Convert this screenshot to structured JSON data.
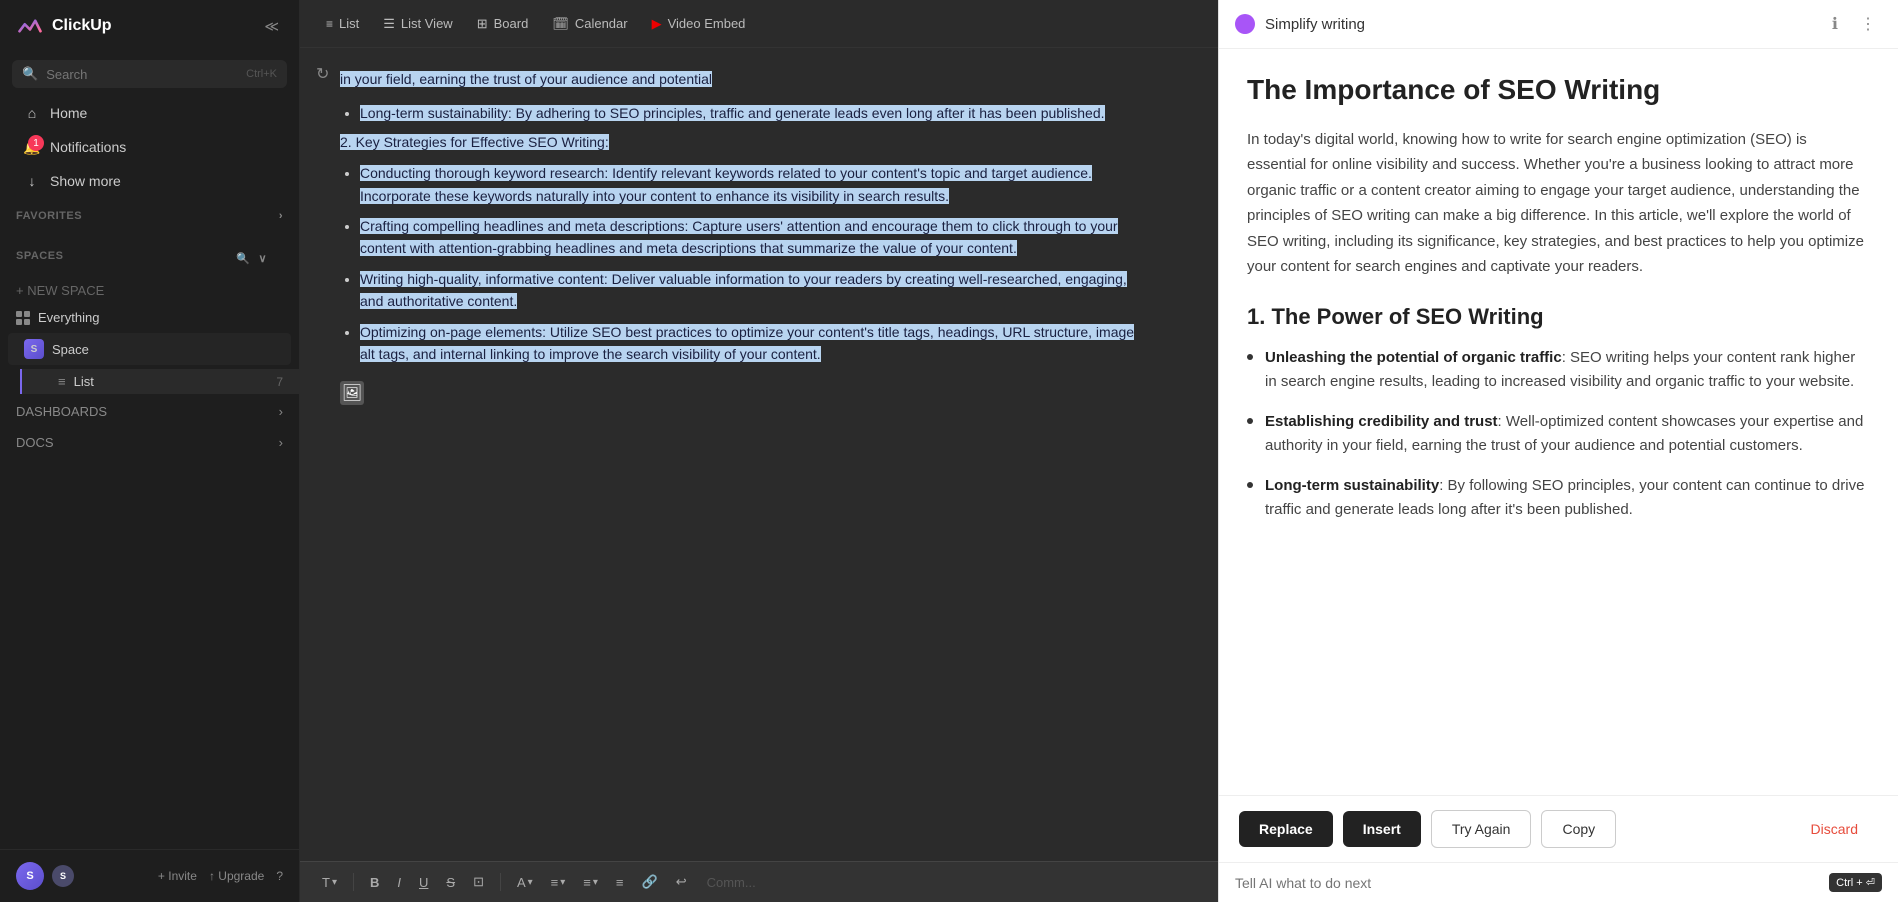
{
  "app": {
    "name": "ClickUp"
  },
  "sidebar": {
    "search_placeholder": "Search",
    "search_shortcut": "Ctrl+K",
    "nav": {
      "home": "Home",
      "notifications": "Notifications",
      "notifications_badge": "1",
      "show_more": "Show more"
    },
    "sections": {
      "favorites": "FAVORITES",
      "spaces": "SPACES"
    },
    "spaces_items": [
      {
        "label": "Everything",
        "icon": "grid"
      },
      {
        "label": "Space",
        "icon": "S"
      }
    ],
    "list_item": {
      "label": "List",
      "count": "7"
    },
    "new_space": "+ NEW SPACE",
    "dashboards": "DASHBOARDS",
    "docs": "DOCS",
    "footer": {
      "invite": "Invite",
      "upgrade": "Upgrade",
      "help": "?"
    }
  },
  "topbar": {
    "tabs": [
      {
        "label": "List",
        "icon": "≡",
        "active": false
      },
      {
        "label": "List View",
        "icon": "☰",
        "active": false
      },
      {
        "label": "Board",
        "icon": "⊞",
        "active": false
      },
      {
        "label": "Calendar",
        "icon": "📅",
        "active": false
      },
      {
        "label": "Video Embed",
        "icon": "▶",
        "active": false
      }
    ]
  },
  "document": {
    "content": {
      "intro_highlighted": "in your field, earning the trust of your audience and potential",
      "bullets_highlighted": [
        {
          "text": "Long-term sustainability: By adhering to SEO principles, traffic and generate leads even long after it has been published.",
          "highlighted": true
        },
        {
          "num": "2.",
          "label": "Key Strategies for Effective SEO Writing:",
          "highlighted": true
        },
        {
          "text": "Conducting thorough keyword research: Identify relevant keywords related to your content's topic and target audience. Incorporate these keywords naturally into your content to enhance its visibility in search results.",
          "highlighted": true
        },
        {
          "text": "Crafting compelling headlines and meta descriptions: Capture users' attention and encourage them to click through to your content with attention-grabbing headlines and meta descriptions that summarize the value of your content.",
          "highlighted": true
        },
        {
          "text": "Writing high-quality, informative content: Deliver valuable information to your readers by creating well-researched, engaging, and authoritative content.",
          "highlighted": true
        },
        {
          "text": "Optimizing on-page elements: Utilize SEO best practices to optimize your content's title tags, headings, URL structure, image alt tags, and internal linking to improve the search visibility of your content.",
          "highlighted": true
        }
      ]
    }
  },
  "toolbar": {
    "buttons": [
      "T",
      "B",
      "I",
      "U",
      "S",
      "⊡",
      "A",
      "≡",
      "≡",
      "≡",
      "🔗",
      "↩",
      "Comm..."
    ]
  },
  "ai_panel": {
    "title": "Simplify writing",
    "main_title": "The Importance of SEO Writing",
    "intro": "In today's digital world, knowing how to write for search engine optimization (SEO) is essential for online visibility and success. Whether you're a business looking to attract more organic traffic or a content creator aiming to engage your target audience, understanding the principles of SEO writing can make a big difference. In this article, we'll explore the world of SEO writing, including its significance, key strategies, and best practices to help you optimize your content for search engines and captivate your readers.",
    "section1_title": "1. The Power of SEO Writing",
    "bullets": [
      {
        "bold": "Unleashing the potential of organic traffic",
        "text": ": SEO writing helps your content rank higher in search engine results, leading to increased visibility and organic traffic to your website."
      },
      {
        "bold": "Establishing credibility and trust",
        "text": ": Well-optimized content showcases your expertise and authority in your field, earning the trust of your audience and potential customers."
      },
      {
        "bold": "Long-term sustainability",
        "text": ": By following SEO principles, your content can continue to drive traffic and generate leads long after it's been published."
      }
    ],
    "actions": {
      "replace": "Replace",
      "insert": "Insert",
      "try_again": "Try Again",
      "copy": "Copy",
      "discard": "Discard"
    },
    "input_placeholder": "Tell AI what to do next",
    "input_shortcut": "Ctrl + ⏎"
  }
}
